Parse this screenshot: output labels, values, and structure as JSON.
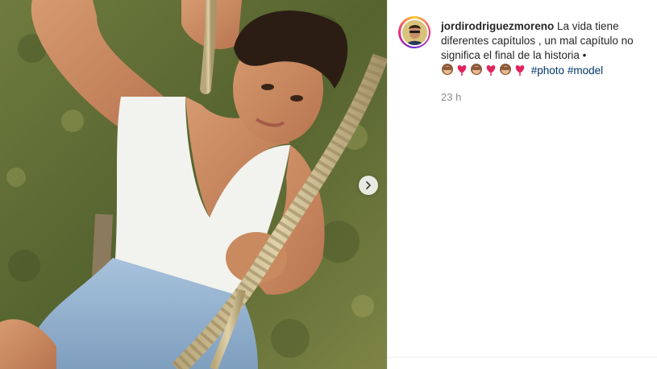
{
  "post": {
    "username": "jordirodriguezmoreno",
    "caption_text": " La vida tiene diferentes capítulos , un mal capítulo no significa el final de la historia •",
    "emoji_sequence": [
      "see-no-evil-monkey",
      "red-heart",
      "see-no-evil-monkey",
      "red-heart",
      "see-no-evil-monkey",
      "red-heart"
    ],
    "hashtags": [
      "#photo",
      "#model"
    ],
    "timestamp": "23 h"
  },
  "colors": {
    "username": "#262626",
    "hashtag": "#00376b",
    "timestamp": "#8e8e8e",
    "heart": "#e0245e"
  },
  "icons": {
    "carousel_next": "chevron-right-icon"
  }
}
